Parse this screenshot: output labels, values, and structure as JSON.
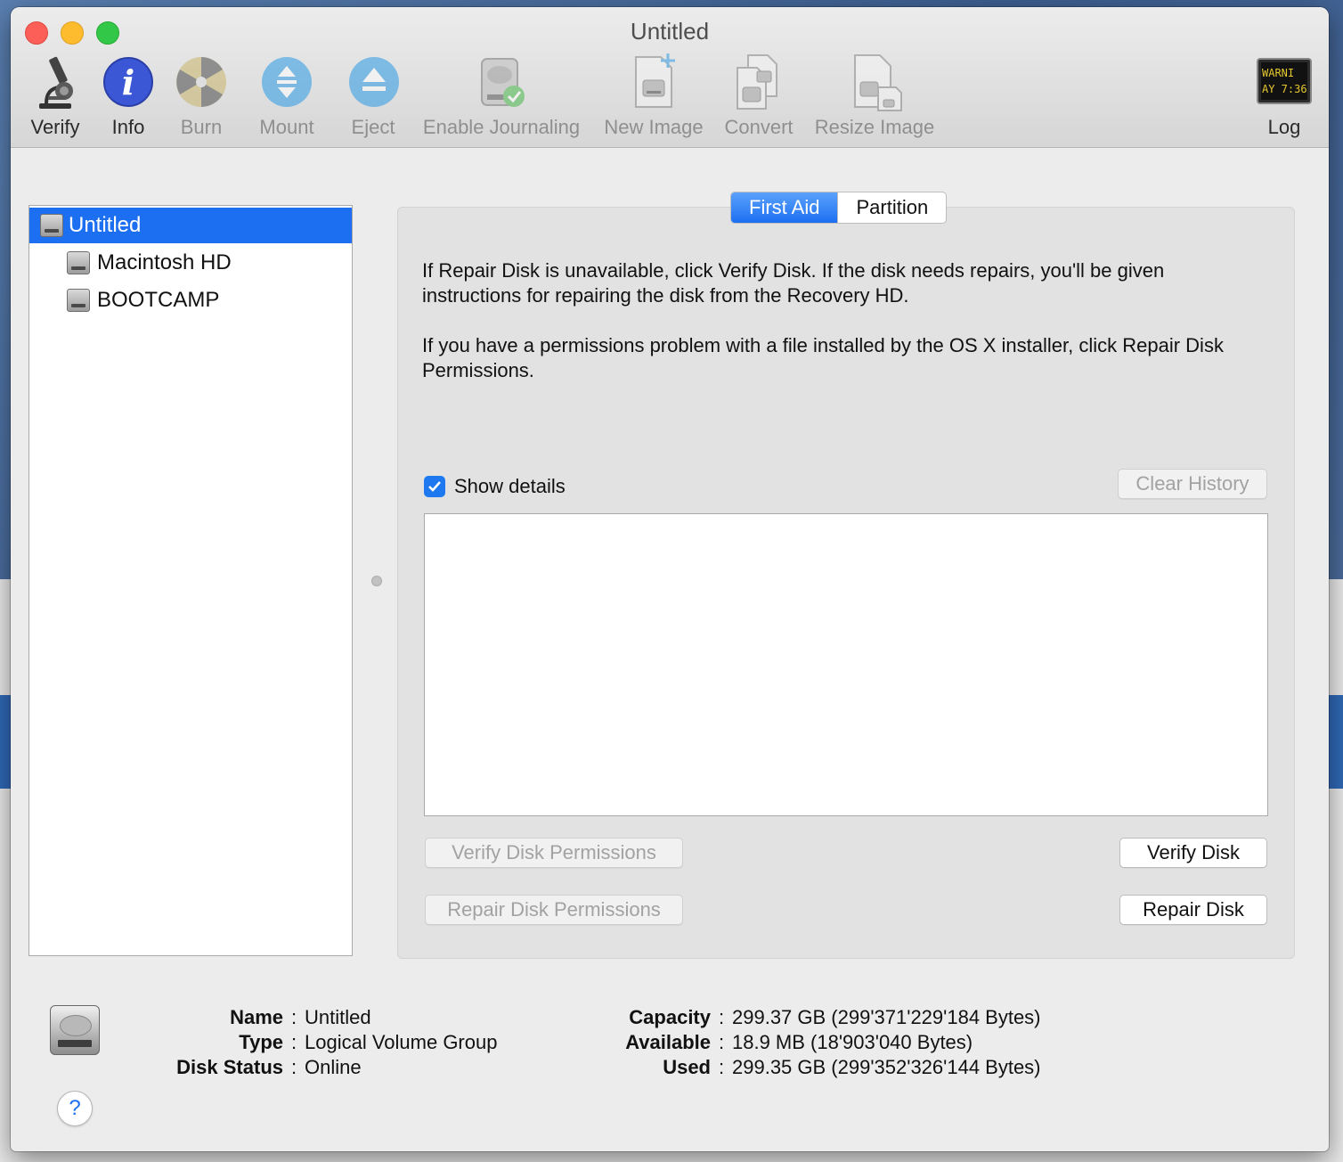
{
  "window": {
    "title": "Untitled"
  },
  "toolbar": {
    "items": [
      {
        "label": "Verify",
        "icon": "microscope-icon",
        "enabled": true
      },
      {
        "label": "Info",
        "icon": "info-icon",
        "enabled": true
      },
      {
        "label": "Burn",
        "icon": "burn-disc-icon",
        "enabled": false
      },
      {
        "label": "Mount",
        "icon": "mount-icon",
        "enabled": false
      },
      {
        "label": "Eject",
        "icon": "eject-icon",
        "enabled": false
      },
      {
        "label": "Enable Journaling",
        "icon": "journaling-icon",
        "enabled": false
      },
      {
        "label": "New Image",
        "icon": "new-image-icon",
        "enabled": false
      },
      {
        "label": "Convert",
        "icon": "convert-icon",
        "enabled": false
      },
      {
        "label": "Resize Image",
        "icon": "resize-image-icon",
        "enabled": false
      }
    ],
    "log": {
      "label": "Log",
      "icon_text_1": "WARNI",
      "icon_text_2": "AY 7:36"
    }
  },
  "sidebar": {
    "items": [
      {
        "label": "Untitled",
        "selected": true
      },
      {
        "label": "Macintosh HD",
        "selected": false
      },
      {
        "label": "BOOTCAMP",
        "selected": false
      }
    ]
  },
  "tabs": {
    "first_aid": "First Aid",
    "partition": "Partition"
  },
  "first_aid": {
    "paragraph_1": "If Repair Disk is unavailable, click Verify Disk. If the disk needs repairs, you'll be given instructions for repairing the disk from the Recovery HD.",
    "paragraph_2": "If you have a permissions problem with a file installed by the OS X installer, click Repair Disk Permissions.",
    "show_details_label": "Show details",
    "show_details_checked": true,
    "clear_history": "Clear History",
    "verify_permissions": "Verify Disk Permissions",
    "repair_permissions": "Repair Disk Permissions",
    "verify_disk": "Verify Disk",
    "repair_disk": "Repair Disk"
  },
  "disk_info": {
    "name_label": "Name",
    "name_value": "Untitled",
    "type_label": "Type",
    "type_value": "Logical Volume Group",
    "status_label": "Disk Status",
    "status_value": "Online",
    "capacity_label": "Capacity",
    "capacity_value": "299.37 GB (299'371'229'184 Bytes)",
    "available_label": "Available",
    "available_value": "18.9 MB (18'903'040 Bytes)",
    "used_label": "Used",
    "used_value": "299.35 GB (299'352'326'144 Bytes)"
  },
  "help": {
    "label": "?"
  },
  "colors": {
    "accent": "#1d6ff2",
    "close": "#fc5f57",
    "minimize": "#fdbc2e",
    "zoom": "#33c748"
  }
}
